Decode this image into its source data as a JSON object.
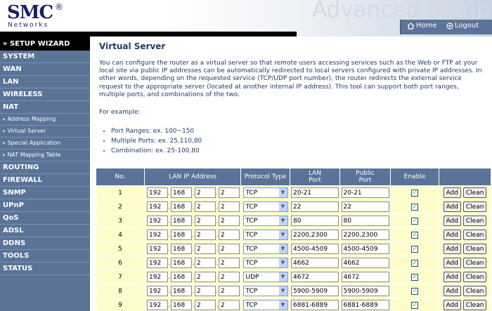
{
  "header": {
    "logo": "SMC",
    "logo_reg": "®",
    "logo_sub": "Networks",
    "app_title": "Advanced Setup",
    "nav": {
      "home": "Home",
      "logout": "Logout"
    }
  },
  "sidebar": {
    "wizard": "» SETUP WIZARD",
    "items": [
      {
        "label": "SYSTEM"
      },
      {
        "label": "WAN"
      },
      {
        "label": "LAN"
      },
      {
        "label": "WIRELESS"
      },
      {
        "label": "NAT"
      }
    ],
    "nat_sub": [
      {
        "label": "» Address Mapping"
      },
      {
        "label": "» Virtual Server"
      },
      {
        "label": "» Special Application"
      },
      {
        "label": "» NAT Mapping Table"
      }
    ],
    "items2": [
      {
        "label": "ROUTING"
      },
      {
        "label": "FIREWALL"
      },
      {
        "label": "SNMP"
      },
      {
        "label": "UPnP"
      },
      {
        "label": "QoS"
      },
      {
        "label": "ADSL"
      },
      {
        "label": "DDNS"
      },
      {
        "label": "TOOLS"
      },
      {
        "label": "STATUS"
      }
    ]
  },
  "main": {
    "title": "Virtual Server",
    "description": "You can configure the router as a virtual server so that remote users accessing services such as the Web or FTP at your local site via public IP addresses can be automatically redirected to local servers configured with private IP addresses. In other words, depending on the requested service (TCP/UDP port number), the router redirects the external service request to the appropriate server (located at another internal IP address). This tool can support both port ranges, multiple ports, and combinations of the two.",
    "example_label": "For example:",
    "examples": [
      "Port Ranges: ex. 100~150",
      "Multiple Ports: ex. 25,110,80",
      "Combination: ex. 25-100,80"
    ]
  },
  "table": {
    "headers": {
      "no": "No.",
      "lan_ip": "LAN IP Address",
      "protocol": "Protocol Type",
      "lan_port_1": "LAN",
      "lan_port_2": "Port",
      "public_port_1": "Public",
      "public_port_2": "Port",
      "enable": "Enable"
    },
    "add_label": "Add",
    "clean_label": "Clean",
    "rows": [
      {
        "no": "1",
        "ip": [
          "192",
          "168",
          "2",
          "2"
        ],
        "protocol": "TCP",
        "lan_port": "20-21",
        "public_port": "20-21",
        "enabled": true
      },
      {
        "no": "2",
        "ip": [
          "192",
          "168",
          "2",
          "2"
        ],
        "protocol": "TCP",
        "lan_port": "22",
        "public_port": "22",
        "enabled": true
      },
      {
        "no": "3",
        "ip": [
          "192",
          "168",
          "2",
          "2"
        ],
        "protocol": "TCP",
        "lan_port": "80",
        "public_port": "80",
        "enabled": true
      },
      {
        "no": "4",
        "ip": [
          "192",
          "168",
          "2",
          "2"
        ],
        "protocol": "TCP",
        "lan_port": "2200,2300",
        "public_port": "2200,2300",
        "enabled": true
      },
      {
        "no": "5",
        "ip": [
          "192",
          "168",
          "2",
          "2"
        ],
        "protocol": "TCP",
        "lan_port": "4500-4509",
        "public_port": "4500-4509",
        "enabled": true
      },
      {
        "no": "6",
        "ip": [
          "192",
          "168",
          "2",
          "2"
        ],
        "protocol": "TCP",
        "lan_port": "4662",
        "public_port": "4662",
        "enabled": true
      },
      {
        "no": "7",
        "ip": [
          "192",
          "168",
          "2",
          "2"
        ],
        "protocol": "UDP",
        "lan_port": "4672",
        "public_port": "4672",
        "enabled": true
      },
      {
        "no": "8",
        "ip": [
          "192",
          "168",
          "2",
          "2"
        ],
        "protocol": "TCP",
        "lan_port": "5900-5909",
        "public_port": "5900-5909",
        "enabled": true
      },
      {
        "no": "9",
        "ip": [
          "192",
          "168",
          "2",
          "2"
        ],
        "protocol": "TCP",
        "lan_port": "6881-6889",
        "public_port": "6881-6889",
        "enabled": true
      }
    ]
  }
}
